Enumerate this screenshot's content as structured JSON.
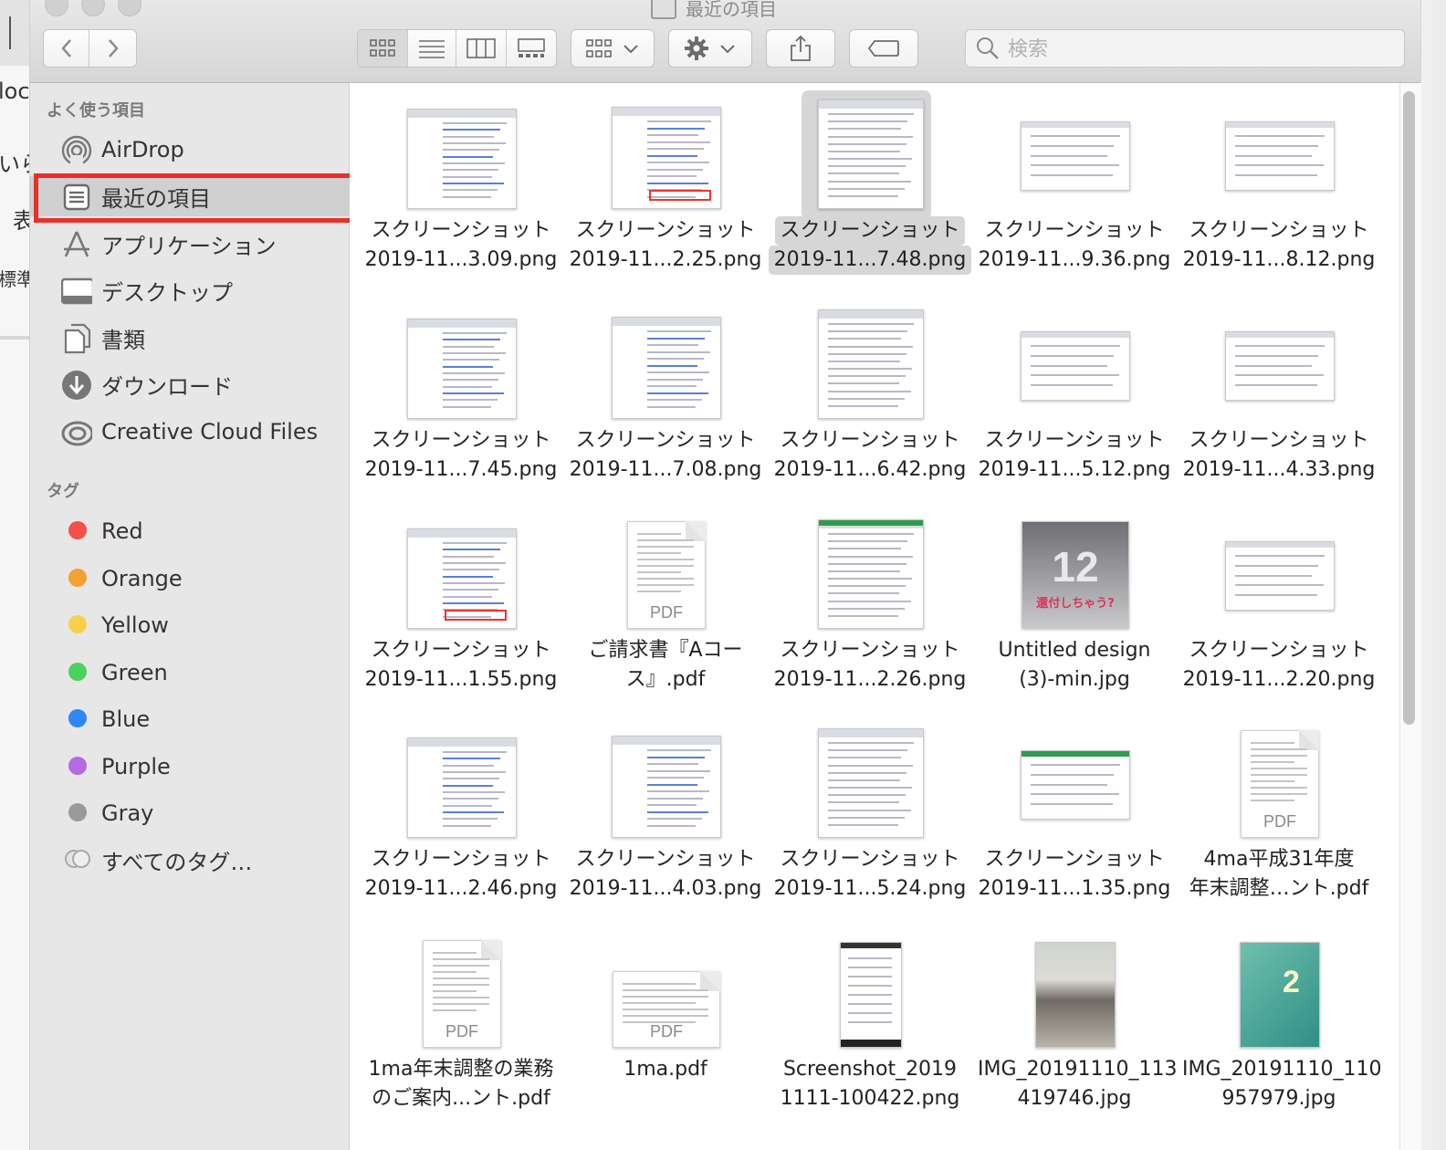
{
  "window": {
    "title": "最近の項目"
  },
  "background_window": {
    "fragments": [
      "loc",
      "いら",
      "表",
      "標準"
    ]
  },
  "search": {
    "placeholder": "検索"
  },
  "sidebar": {
    "favorites_header": "よく使う項目",
    "favorites": [
      {
        "label": "AirDrop",
        "icon": "airdrop-icon"
      },
      {
        "label": "最近の項目",
        "icon": "recents-icon",
        "selected": true
      },
      {
        "label": "アプリケーション",
        "icon": "applications-icon"
      },
      {
        "label": "デスクトップ",
        "icon": "desktop-icon"
      },
      {
        "label": "書類",
        "icon": "documents-icon"
      },
      {
        "label": "ダウンロード",
        "icon": "downloads-icon"
      },
      {
        "label": "Creative Cloud Files",
        "icon": "creative-cloud-icon"
      }
    ],
    "tags_header": "タグ",
    "tags": [
      {
        "label": "Red",
        "color": "#f2504b"
      },
      {
        "label": "Orange",
        "color": "#f5a033"
      },
      {
        "label": "Yellow",
        "color": "#f7d248"
      },
      {
        "label": "Green",
        "color": "#4cd05e"
      },
      {
        "label": "Blue",
        "color": "#2f87f5"
      },
      {
        "label": "Purple",
        "color": "#b46ae0"
      },
      {
        "label": "Gray",
        "color": "#9a9a9a"
      },
      {
        "label": "すべてのタグ…",
        "color": ""
      }
    ]
  },
  "files": [
    {
      "line1": "スクリーンショット",
      "line2": "2019-11...3.09.png",
      "kind": "shot"
    },
    {
      "line1": "スクリーンショット",
      "line2": "2019-11...2.25.png",
      "kind": "shot"
    },
    {
      "line1": "スクリーンショット",
      "line2": "2019-11...7.48.png",
      "kind": "shot",
      "selected": true
    },
    {
      "line1": "スクリーンショット",
      "line2": "2019-11...9.36.png",
      "kind": "shot"
    },
    {
      "line1": "スクリーンショット",
      "line2": "2019-11...8.12.png",
      "kind": "shot"
    },
    {
      "line1": "スクリーンショット",
      "line2": "2019-11...7.45.png",
      "kind": "shot"
    },
    {
      "line1": "スクリーンショット",
      "line2": "2019-11...7.08.png",
      "kind": "shot"
    },
    {
      "line1": "スクリーンショット",
      "line2": "2019-11...6.42.png",
      "kind": "shot"
    },
    {
      "line1": "スクリーンショット",
      "line2": "2019-11...5.12.png",
      "kind": "shot"
    },
    {
      "line1": "スクリーンショット",
      "line2": "2019-11...4.33.png",
      "kind": "shot"
    },
    {
      "line1": "スクリーンショット",
      "line2": "2019-11...1.55.png",
      "kind": "shot"
    },
    {
      "line1": "ご請求書『Aコー",
      "line2": "ス』.pdf",
      "kind": "pdf",
      "badge": "PDF"
    },
    {
      "line1": "スクリーンショット",
      "line2": "2019-11...2.26.png",
      "kind": "shot"
    },
    {
      "line1": "Untitled design",
      "line2": "(3)-min.jpg",
      "kind": "image",
      "overlay": "12",
      "caption": "還付しちゃう?"
    },
    {
      "line1": "スクリーンショット",
      "line2": "2019-11...2.20.png",
      "kind": "shot"
    },
    {
      "line1": "スクリーンショット",
      "line2": "2019-11...2.46.png",
      "kind": "shot"
    },
    {
      "line1": "スクリーンショット",
      "line2": "2019-11...4.03.png",
      "kind": "shot"
    },
    {
      "line1": "スクリーンショット",
      "line2": "2019-11...5.24.png",
      "kind": "shot"
    },
    {
      "line1": "スクリーンショット",
      "line2": "2019-11...1.35.png",
      "kind": "shot"
    },
    {
      "line1": "4ma平成31年度",
      "line2": "年末調整…ント.pdf",
      "kind": "pdf",
      "badge": "PDF"
    },
    {
      "line1": "1ma年末調整の業務",
      "line2": "のご案内...ント.pdf",
      "kind": "pdf",
      "badge": "PDF"
    },
    {
      "line1": "1ma.pdf",
      "line2": "",
      "kind": "pdf-wide",
      "badge": "PDF"
    },
    {
      "line1": "Screenshot_2019",
      "line2": "1111-100422.png",
      "kind": "phone"
    },
    {
      "line1": "IMG_20191110_113",
      "line2": "419746.jpg",
      "kind": "photo"
    },
    {
      "line1": "IMG_20191110_110",
      "line2": "957979.jpg",
      "kind": "photo-book",
      "overlay": "2"
    }
  ]
}
